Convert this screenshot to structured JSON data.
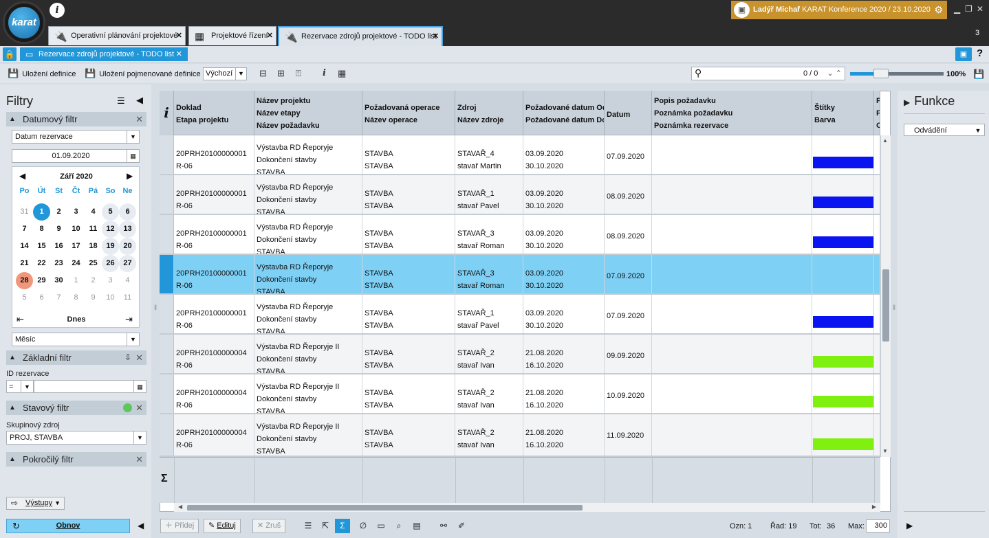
{
  "app": {
    "logo_text": "karat",
    "info_icon": "info-icon"
  },
  "user": {
    "name": "Ladýř Michal",
    "context": "/ KARAT Konference 2020 / 23.10.2020"
  },
  "doc_tabs": [
    {
      "label": "Operativní plánování projektové",
      "icon": "plug-icon"
    },
    {
      "label": "Projektové řízení",
      "icon": "calculator-icon"
    },
    {
      "label": "Rezervace zdrojů projektové - TODO list",
      "icon": "plug-icon"
    }
  ],
  "tab_count": "3",
  "subtab": {
    "label": "Rezervace zdrojů projektové - TODO list"
  },
  "toolbar": {
    "save_def": "Uložení definice",
    "save_named_def": "Uložení pojmenované definice",
    "definition_value": "Výchozí",
    "search_count": "0 / 0",
    "zoom": "100%",
    "zoom_level": 0.28
  },
  "filters": {
    "title": "Filtry",
    "date_filter": {
      "title": "Datumový filtr",
      "type_value": "Datum rezervace",
      "date_value": "01.09.2020",
      "month_label": "Září 2020",
      "dow": [
        "Po",
        "Út",
        "St",
        "Čt",
        "Pá",
        "So",
        "Ne"
      ],
      "weeks": [
        [
          "31",
          "1",
          "2",
          "3",
          "4",
          "5",
          "6"
        ],
        [
          "7",
          "8",
          "9",
          "10",
          "11",
          "12",
          "13"
        ],
        [
          "14",
          "15",
          "16",
          "17",
          "18",
          "19",
          "20"
        ],
        [
          "21",
          "22",
          "23",
          "24",
          "25",
          "26",
          "27"
        ],
        [
          "28",
          "29",
          "30",
          "1",
          "2",
          "3",
          "4"
        ],
        [
          "5",
          "6",
          "7",
          "8",
          "9",
          "10",
          "11"
        ]
      ],
      "today_label": "Dnes",
      "period_value": "Měsíc"
    },
    "basic_filter": {
      "title": "Základní filtr",
      "id_label": "ID rezervace",
      "op_value": "="
    },
    "state_filter": {
      "title": "Stavový filtr",
      "group_label": "Skupinový zdroj",
      "group_value": "PROJ, STAVBA"
    },
    "advanced_filter": {
      "title": "Pokročilý filtr"
    },
    "outputs_label": "Výstupy",
    "refresh_label": "Obnov"
  },
  "grid": {
    "headers": {
      "doklad": [
        "Doklad",
        "Etapa projektu"
      ],
      "projekt": [
        "Název projektu",
        "Název etapy",
        "Název požadavku"
      ],
      "operace": [
        "Požadovaná operace",
        "Název operace"
      ],
      "zdroj": [
        "Zdroj",
        "Název zdroje"
      ],
      "datum_od": [
        "Požadované datum Od",
        "Požadované datum Do"
      ],
      "datum": [
        "Datum"
      ],
      "popis": [
        "Popis požadavku",
        "Poznámka požadavku",
        "Poznámka rezervace"
      ],
      "stitky": [
        "Štítky",
        "Barva"
      ],
      "extra": [
        "P",
        "P",
        "O"
      ]
    },
    "rows": [
      {
        "doklad": "20PRH20100000001",
        "etapa": "R-06",
        "projekt": "Výstavba RD Řeporyje",
        "etapa_nazev": "Dokončení stavby",
        "pozadavek": "STAVBA",
        "operace": "STAVBA",
        "operace_nazev": "STAVBA",
        "zdroj": "STAVAŘ_4",
        "zdroj_nazev": "stavař Martin",
        "od": "03.09.2020",
        "do": "30.10.2020",
        "datum": "07.09.2020",
        "barva": "#0a14f0"
      },
      {
        "doklad": "20PRH20100000001",
        "etapa": "R-06",
        "projekt": "Výstavba RD Řeporyje",
        "etapa_nazev": "Dokončení stavby",
        "pozadavek": "STAVBA",
        "operace": "STAVBA",
        "operace_nazev": "STAVBA",
        "zdroj": "STAVAŘ_1",
        "zdroj_nazev": "stavař Pavel",
        "od": "03.09.2020",
        "do": "30.10.2020",
        "datum": "08.09.2020",
        "barva": "#0a14f0"
      },
      {
        "doklad": "20PRH20100000001",
        "etapa": "R-06",
        "projekt": "Výstavba RD Řeporyje",
        "etapa_nazev": "Dokončení stavby",
        "pozadavek": "STAVBA",
        "operace": "STAVBA",
        "operace_nazev": "STAVBA",
        "zdroj": "STAVAŘ_3",
        "zdroj_nazev": "stavař Roman",
        "od": "03.09.2020",
        "do": "30.10.2020",
        "datum": "08.09.2020",
        "barva": "#0a14f0"
      },
      {
        "doklad": "20PRH20100000001",
        "etapa": "R-06",
        "projekt": "Výstavba RD Řeporyje",
        "etapa_nazev": "Dokončení stavby",
        "pozadavek": "STAVBA",
        "operace": "STAVBA",
        "operace_nazev": "STAVBA",
        "zdroj": "STAVAŘ_3",
        "zdroj_nazev": "stavař Roman",
        "od": "03.09.2020",
        "do": "30.10.2020",
        "datum": "07.09.2020",
        "barva": ""
      },
      {
        "doklad": "20PRH20100000001",
        "etapa": "R-06",
        "projekt": "Výstavba RD Řeporyje",
        "etapa_nazev": "Dokončení stavby",
        "pozadavek": "STAVBA",
        "operace": "STAVBA",
        "operace_nazev": "STAVBA",
        "zdroj": "STAVAŘ_1",
        "zdroj_nazev": "stavař Pavel",
        "od": "03.09.2020",
        "do": "30.10.2020",
        "datum": "07.09.2020",
        "barva": "#0a14f0"
      },
      {
        "doklad": "20PRH20100000004",
        "etapa": "R-06",
        "projekt": "Výstavba RD Řeporyje II",
        "etapa_nazev": "Dokončení stavby",
        "pozadavek": "STAVBA",
        "operace": "STAVBA",
        "operace_nazev": "STAVBA",
        "zdroj": "STAVAŘ_2",
        "zdroj_nazev": "stavař Ivan",
        "od": "21.08.2020",
        "do": "16.10.2020",
        "datum": "09.09.2020",
        "barva": "#80f010"
      },
      {
        "doklad": "20PRH20100000004",
        "etapa": "R-06",
        "projekt": "Výstavba RD Řeporyje II",
        "etapa_nazev": "Dokončení stavby",
        "pozadavek": "STAVBA",
        "operace": "STAVBA",
        "operace_nazev": "STAVBA",
        "zdroj": "STAVAŘ_2",
        "zdroj_nazev": "stavař Ivan",
        "od": "21.08.2020",
        "do": "16.10.2020",
        "datum": "10.09.2020",
        "barva": "#80f010"
      },
      {
        "doklad": "20PRH20100000004",
        "etapa": "R-06",
        "projekt": "Výstavba RD Řeporyje II",
        "etapa_nazev": "Dokončení stavby",
        "pozadavek": "STAVBA",
        "operace": "STAVBA",
        "operace_nazev": "STAVBA",
        "zdroj": "STAVAŘ_2",
        "zdroj_nazev": "stavař Ivan",
        "od": "21.08.2020",
        "do": "16.10.2020",
        "datum": "11.09.2020",
        "barva": "#80f010"
      }
    ],
    "sum_symbol": "Σ"
  },
  "bottom": {
    "add": "Přidej",
    "edit": "Edituj",
    "cancel": "Zruš",
    "ozn": "Ozn: 1",
    "rad": "Řad: 19",
    "tot_label": "Tot:",
    "tot_value": "36",
    "max_label": "Max:",
    "max_value": "300"
  },
  "right_panel": {
    "title": "Funkce",
    "select_value": "Odvádění"
  },
  "colors": {
    "accent": "#2196d8",
    "selected_row": "#7fd0f5",
    "user_bar": "#c8922d"
  }
}
